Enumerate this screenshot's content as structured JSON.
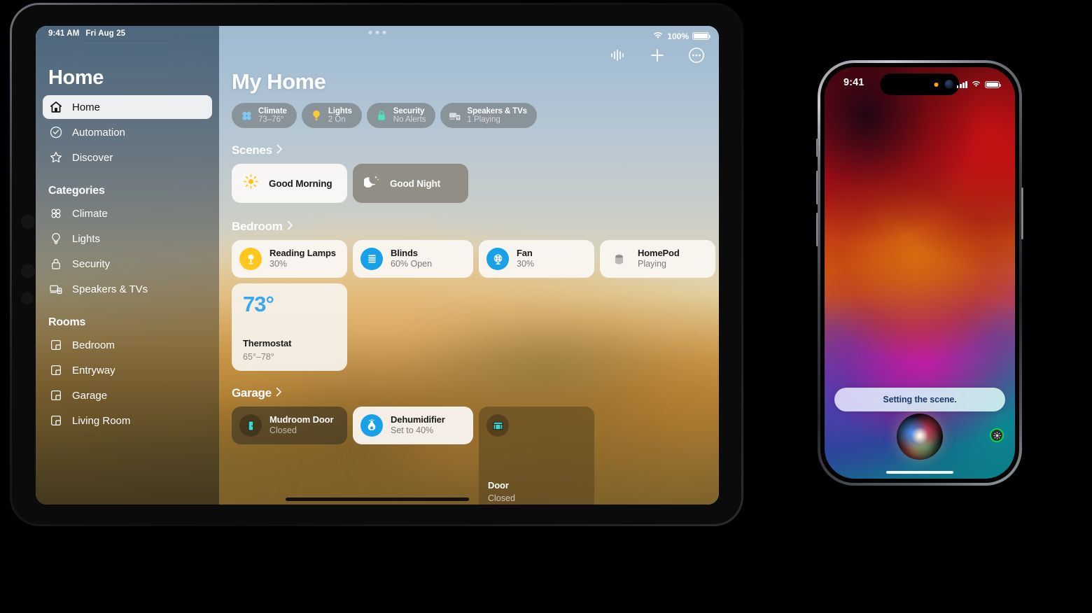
{
  "ipad": {
    "status_bar": {
      "time": "9:41 AM",
      "date": "Fri Aug 25",
      "battery_percent": "100%",
      "wifi_icon": "wifi-icon",
      "battery_icon": "battery-icon"
    },
    "sidebar": {
      "title": "Home",
      "top_items": [
        {
          "label": "Home",
          "icon": "house-icon",
          "selected": true
        },
        {
          "label": "Automation",
          "icon": "clock-check-icon",
          "selected": false
        },
        {
          "label": "Discover",
          "icon": "star-icon",
          "selected": false
        }
      ],
      "categories_header": "Categories",
      "categories": [
        {
          "label": "Climate",
          "icon": "fan-icon"
        },
        {
          "label": "Lights",
          "icon": "lightbulb-icon"
        },
        {
          "label": "Security",
          "icon": "lock-icon"
        },
        {
          "label": "Speakers & TVs",
          "icon": "speaker-tv-icon"
        }
      ],
      "rooms_header": "Rooms",
      "rooms": [
        {
          "label": "Bedroom",
          "icon": "room-icon"
        },
        {
          "label": "Entryway",
          "icon": "room-icon"
        },
        {
          "label": "Garage",
          "icon": "room-icon"
        },
        {
          "label": "Living Room",
          "icon": "room-icon"
        }
      ]
    },
    "toolbar": [
      {
        "name": "audio-waveform-button",
        "icon": "waveform-icon"
      },
      {
        "name": "add-button",
        "icon": "plus-icon"
      },
      {
        "name": "more-options-button",
        "icon": "ellipsis-circle-icon"
      }
    ],
    "main": {
      "title": "My Home",
      "status_pills": [
        {
          "icon": "fan-icon",
          "title": "Climate",
          "value": "73–76°",
          "accent": "#7ec8f0"
        },
        {
          "icon": "lightbulb-icon",
          "title": "Lights",
          "value": "2 On",
          "accent": "#ffcb2e"
        },
        {
          "icon": "lock-icon",
          "title": "Security",
          "value": "No Alerts",
          "accent": "#4ee0c0"
        },
        {
          "icon": "speaker-tv-icon",
          "title": "Speakers & TVs",
          "value": "1 Playing",
          "accent": "#d8dde2"
        }
      ],
      "sections": [
        {
          "header": "Scenes",
          "scenes": [
            {
              "label": "Good Morning",
              "icon": "sun-icon",
              "state": "light"
            },
            {
              "label": "Good Night",
              "icon": "moon-stars-icon",
              "state": "dark"
            }
          ]
        },
        {
          "header": "Bedroom",
          "accessories": [
            {
              "name": "Reading Lamps",
              "status": "30%",
              "icon": "lamp-icon",
              "state": "on",
              "badge_color": "#ffc61e"
            },
            {
              "name": "Blinds",
              "status": "60% Open",
              "icon": "blinds-icon",
              "state": "on",
              "badge_color": "#18a0e8"
            },
            {
              "name": "Fan",
              "status": "30%",
              "icon": "fan-circle-icon",
              "state": "on",
              "badge_color": "#18a0e8"
            },
            {
              "name": "HomePod",
              "status": "Playing",
              "icon": "homepod-icon",
              "state": "on",
              "badge_color": "#b9b6b1"
            }
          ],
          "thermostat": {
            "temperature": "73°",
            "name": "Thermostat",
            "range": "65°–78°",
            "temp_color": "#3aa8ee"
          }
        },
        {
          "header": "Garage",
          "accessories": [
            {
              "name": "Mudroom Door",
              "status": "Closed",
              "icon": "door-icon",
              "state": "off",
              "badge_color": "#3dd9c8"
            },
            {
              "name": "Dehumidifier",
              "status": "Set to 40%",
              "icon": "dehumidifier-icon",
              "state": "on",
              "badge_color": "#18a0e8"
            }
          ],
          "large_tile": {
            "name": "Door",
            "status": "Closed",
            "icon": "garage-door-icon",
            "state": "off"
          }
        }
      ]
    }
  },
  "iphone": {
    "status_bar": {
      "time": "9:41",
      "cellular_icon": "signal-bars-icon",
      "wifi_icon": "wifi-icon",
      "battery_icon": "battery-icon"
    },
    "siri": {
      "message": "Setting the scene.",
      "orb_icon": "siri-orb-icon"
    },
    "control": {
      "icon": "brightness-icon",
      "ring_color": "#16d14a"
    }
  }
}
